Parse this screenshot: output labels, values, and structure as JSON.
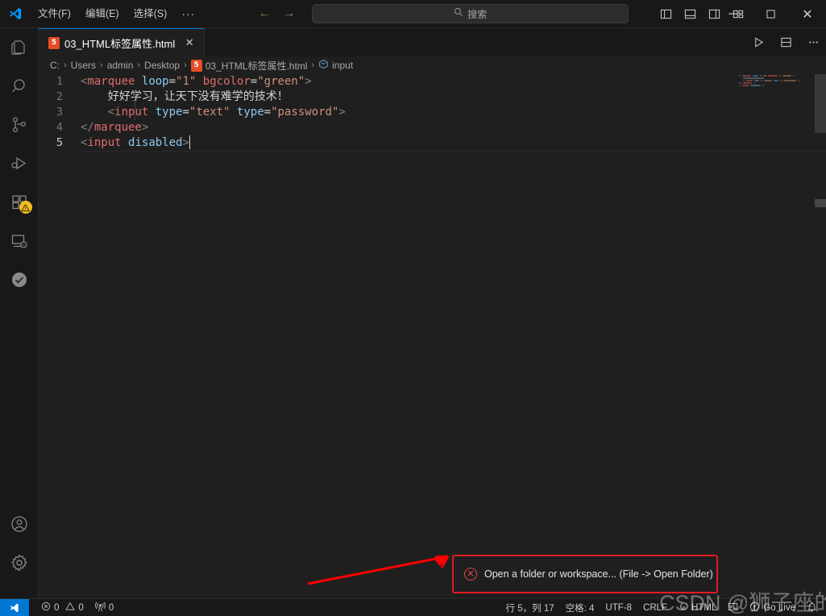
{
  "titlebar": {
    "logo_icon": "vscode-logo-icon",
    "menus": [
      {
        "label": "文件(F)",
        "name": "menu-file"
      },
      {
        "label": "编辑(E)",
        "name": "menu-edit"
      },
      {
        "label": "选择(S)",
        "name": "menu-selection"
      }
    ],
    "overflow_label": "···",
    "back_arrow": "←",
    "forward_arrow": "→",
    "search": {
      "placeholder": "搜索",
      "value": "",
      "icon": "search-icon"
    },
    "layout_icons": [
      "toggle-primary-sidebar-icon",
      "toggle-panel-icon",
      "toggle-secondary-sidebar-icon",
      "customize-layout-icon"
    ],
    "window_controls": {
      "minimize": "─",
      "maximize": "☐",
      "close": "✕"
    }
  },
  "activitybar": {
    "items": [
      {
        "name": "activity-explorer",
        "icon": "files-icon"
      },
      {
        "name": "activity-search",
        "icon": "search-icon"
      },
      {
        "name": "activity-source-control",
        "icon": "source-control-icon"
      },
      {
        "name": "activity-run-debug",
        "icon": "run-and-debug-icon"
      },
      {
        "name": "activity-extensions",
        "icon": "extensions-icon",
        "badge": "warning"
      },
      {
        "name": "activity-remote-explorer",
        "icon": "remote-explorer-icon"
      },
      {
        "name": "activity-testing",
        "icon": "check-circle-icon"
      }
    ],
    "bottom": [
      {
        "name": "activity-accounts",
        "icon": "account-icon"
      },
      {
        "name": "activity-settings",
        "icon": "gear-icon"
      }
    ]
  },
  "editor": {
    "tab": {
      "filename": "03_HTML标签属性.html",
      "file_icon": "html5-icon",
      "file_icon_label": "5",
      "close_label": "✕"
    },
    "tab_actions": [
      {
        "name": "run-file-button",
        "icon": "play-icon"
      },
      {
        "name": "split-editor-button",
        "icon": "split-editor-icon"
      },
      {
        "name": "more-actions-button",
        "icon": "ellipsis-icon"
      }
    ],
    "breadcrumb": {
      "separator": "›",
      "items": [
        "C:",
        "Users",
        "admin",
        "Desktop",
        "03_HTML标签属性.html",
        "input"
      ],
      "file_index": 4,
      "symbol_index": 5,
      "file_icon_label": "5"
    },
    "code": {
      "lines": [
        {
          "num": "1",
          "indent": 0,
          "tokens": [
            {
              "t": "<",
              "c": "tok-bracket"
            },
            {
              "t": "marquee",
              "c": "tok-tag"
            },
            {
              "t": " ",
              "c": "tok-plain"
            },
            {
              "t": "loop",
              "c": "tok-attr"
            },
            {
              "t": "=",
              "c": "tok-eq"
            },
            {
              "t": "\"1\"",
              "c": "tok-str"
            },
            {
              "t": " ",
              "c": "tok-plain"
            },
            {
              "t": "bgcolor",
              "c": "tok-attr2"
            },
            {
              "t": "=",
              "c": "tok-eq"
            },
            {
              "t": "\"green\"",
              "c": "tok-str"
            },
            {
              "t": ">",
              "c": "tok-bracket"
            }
          ]
        },
        {
          "num": "2",
          "indent": 1,
          "tokens": [
            {
              "t": "    好好学习，让天下没有难学的技术！",
              "c": "tok-plain"
            }
          ]
        },
        {
          "num": "3",
          "indent": 1,
          "tokens": [
            {
              "t": "    ",
              "c": "tok-plain"
            },
            {
              "t": "<",
              "c": "tok-bracket"
            },
            {
              "t": "input",
              "c": "tok-tag"
            },
            {
              "t": " ",
              "c": "tok-plain"
            },
            {
              "t": "type",
              "c": "tok-attr"
            },
            {
              "t": "=",
              "c": "tok-eq"
            },
            {
              "t": "\"text\"",
              "c": "tok-str"
            },
            {
              "t": " ",
              "c": "tok-plain"
            },
            {
              "t": "type",
              "c": "tok-attr"
            },
            {
              "t": "=",
              "c": "tok-eq"
            },
            {
              "t": "\"password\"",
              "c": "tok-str"
            },
            {
              "t": ">",
              "c": "tok-bracket"
            }
          ]
        },
        {
          "num": "4",
          "indent": 0,
          "tokens": [
            {
              "t": "</",
              "c": "tok-bracket"
            },
            {
              "t": "marquee",
              "c": "tok-tag"
            },
            {
              "t": ">",
              "c": "tok-bracket"
            }
          ]
        },
        {
          "num": "5",
          "indent": 0,
          "active": true,
          "cursor": true,
          "tokens": [
            {
              "t": "<",
              "c": "tok-bracket"
            },
            {
              "t": "input",
              "c": "tok-tag"
            },
            {
              "t": " ",
              "c": "tok-plain"
            },
            {
              "t": "disabled",
              "c": "tok-attr"
            },
            {
              "t": ">",
              "c": "tok-bracket"
            }
          ]
        }
      ]
    }
  },
  "notification": {
    "icon": "error-circle-icon",
    "message": "Open a folder or workspace... (File -> Open Folder)",
    "border_color": "#e01b24"
  },
  "annotation": {
    "arrow_color": "#ff0000",
    "name": "red-arrow-annotation"
  },
  "watermark": {
    "text": "CSDN @狮子座的男孩"
  },
  "statusbar": {
    "remote_icon": "remote-window-icon",
    "left": [
      {
        "name": "status-errors",
        "icon": "error-icon",
        "label": "0"
      },
      {
        "name": "status-warnings",
        "icon": "warning-icon",
        "label": "0"
      },
      {
        "name": "status-ports",
        "icon": "radio-tower-icon",
        "label": "0"
      }
    ],
    "right": [
      {
        "name": "status-cursor-position",
        "label": "行 5，列 17"
      },
      {
        "name": "status-indentation",
        "label": "空格: 4"
      },
      {
        "name": "status-encoding",
        "label": "UTF-8"
      },
      {
        "name": "status-eol",
        "label": "CRLF"
      },
      {
        "name": "status-language-mode",
        "label": "HTML",
        "icon": "html-lang-icon"
      },
      {
        "name": "status-terminal",
        "label": "",
        "icon": "terminal-icon"
      },
      {
        "name": "status-go-live",
        "label": "Go Live",
        "icon": "broadcast-icon"
      },
      {
        "name": "status-notifications",
        "label": "",
        "icon": "bell-icon"
      }
    ]
  }
}
